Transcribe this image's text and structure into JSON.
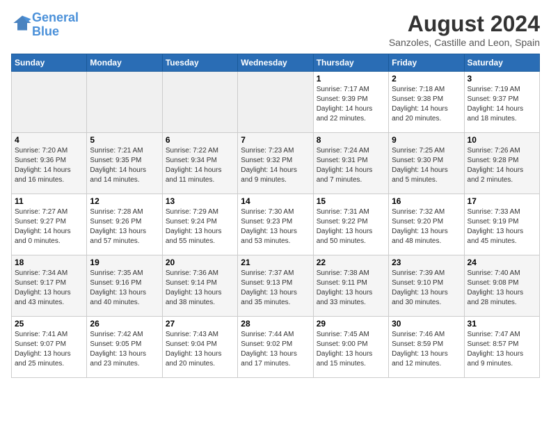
{
  "header": {
    "logo_line1": "General",
    "logo_line2": "Blue",
    "month_year": "August 2024",
    "location": "Sanzoles, Castille and Leon, Spain"
  },
  "weekdays": [
    "Sunday",
    "Monday",
    "Tuesday",
    "Wednesday",
    "Thursday",
    "Friday",
    "Saturday"
  ],
  "weeks": [
    [
      {
        "day": "",
        "info": ""
      },
      {
        "day": "",
        "info": ""
      },
      {
        "day": "",
        "info": ""
      },
      {
        "day": "",
        "info": ""
      },
      {
        "day": "1",
        "info": "Sunrise: 7:17 AM\nSunset: 9:39 PM\nDaylight: 14 hours\nand 22 minutes."
      },
      {
        "day": "2",
        "info": "Sunrise: 7:18 AM\nSunset: 9:38 PM\nDaylight: 14 hours\nand 20 minutes."
      },
      {
        "day": "3",
        "info": "Sunrise: 7:19 AM\nSunset: 9:37 PM\nDaylight: 14 hours\nand 18 minutes."
      }
    ],
    [
      {
        "day": "4",
        "info": "Sunrise: 7:20 AM\nSunset: 9:36 PM\nDaylight: 14 hours\nand 16 minutes."
      },
      {
        "day": "5",
        "info": "Sunrise: 7:21 AM\nSunset: 9:35 PM\nDaylight: 14 hours\nand 14 minutes."
      },
      {
        "day": "6",
        "info": "Sunrise: 7:22 AM\nSunset: 9:34 PM\nDaylight: 14 hours\nand 11 minutes."
      },
      {
        "day": "7",
        "info": "Sunrise: 7:23 AM\nSunset: 9:32 PM\nDaylight: 14 hours\nand 9 minutes."
      },
      {
        "day": "8",
        "info": "Sunrise: 7:24 AM\nSunset: 9:31 PM\nDaylight: 14 hours\nand 7 minutes."
      },
      {
        "day": "9",
        "info": "Sunrise: 7:25 AM\nSunset: 9:30 PM\nDaylight: 14 hours\nand 5 minutes."
      },
      {
        "day": "10",
        "info": "Sunrise: 7:26 AM\nSunset: 9:28 PM\nDaylight: 14 hours\nand 2 minutes."
      }
    ],
    [
      {
        "day": "11",
        "info": "Sunrise: 7:27 AM\nSunset: 9:27 PM\nDaylight: 14 hours\nand 0 minutes."
      },
      {
        "day": "12",
        "info": "Sunrise: 7:28 AM\nSunset: 9:26 PM\nDaylight: 13 hours\nand 57 minutes."
      },
      {
        "day": "13",
        "info": "Sunrise: 7:29 AM\nSunset: 9:24 PM\nDaylight: 13 hours\nand 55 minutes."
      },
      {
        "day": "14",
        "info": "Sunrise: 7:30 AM\nSunset: 9:23 PM\nDaylight: 13 hours\nand 53 minutes."
      },
      {
        "day": "15",
        "info": "Sunrise: 7:31 AM\nSunset: 9:22 PM\nDaylight: 13 hours\nand 50 minutes."
      },
      {
        "day": "16",
        "info": "Sunrise: 7:32 AM\nSunset: 9:20 PM\nDaylight: 13 hours\nand 48 minutes."
      },
      {
        "day": "17",
        "info": "Sunrise: 7:33 AM\nSunset: 9:19 PM\nDaylight: 13 hours\nand 45 minutes."
      }
    ],
    [
      {
        "day": "18",
        "info": "Sunrise: 7:34 AM\nSunset: 9:17 PM\nDaylight: 13 hours\nand 43 minutes."
      },
      {
        "day": "19",
        "info": "Sunrise: 7:35 AM\nSunset: 9:16 PM\nDaylight: 13 hours\nand 40 minutes."
      },
      {
        "day": "20",
        "info": "Sunrise: 7:36 AM\nSunset: 9:14 PM\nDaylight: 13 hours\nand 38 minutes."
      },
      {
        "day": "21",
        "info": "Sunrise: 7:37 AM\nSunset: 9:13 PM\nDaylight: 13 hours\nand 35 minutes."
      },
      {
        "day": "22",
        "info": "Sunrise: 7:38 AM\nSunset: 9:11 PM\nDaylight: 13 hours\nand 33 minutes."
      },
      {
        "day": "23",
        "info": "Sunrise: 7:39 AM\nSunset: 9:10 PM\nDaylight: 13 hours\nand 30 minutes."
      },
      {
        "day": "24",
        "info": "Sunrise: 7:40 AM\nSunset: 9:08 PM\nDaylight: 13 hours\nand 28 minutes."
      }
    ],
    [
      {
        "day": "25",
        "info": "Sunrise: 7:41 AM\nSunset: 9:07 PM\nDaylight: 13 hours\nand 25 minutes."
      },
      {
        "day": "26",
        "info": "Sunrise: 7:42 AM\nSunset: 9:05 PM\nDaylight: 13 hours\nand 23 minutes."
      },
      {
        "day": "27",
        "info": "Sunrise: 7:43 AM\nSunset: 9:04 PM\nDaylight: 13 hours\nand 20 minutes."
      },
      {
        "day": "28",
        "info": "Sunrise: 7:44 AM\nSunset: 9:02 PM\nDaylight: 13 hours\nand 17 minutes."
      },
      {
        "day": "29",
        "info": "Sunrise: 7:45 AM\nSunset: 9:00 PM\nDaylight: 13 hours\nand 15 minutes."
      },
      {
        "day": "30",
        "info": "Sunrise: 7:46 AM\nSunset: 8:59 PM\nDaylight: 13 hours\nand 12 minutes."
      },
      {
        "day": "31",
        "info": "Sunrise: 7:47 AM\nSunset: 8:57 PM\nDaylight: 13 hours\nand 9 minutes."
      }
    ]
  ]
}
